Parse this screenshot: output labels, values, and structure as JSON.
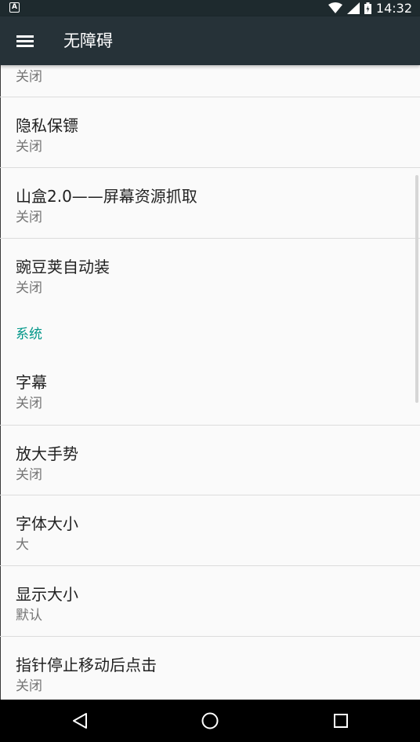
{
  "status_bar": {
    "time": "14:32",
    "left_icon": "A"
  },
  "app_bar": {
    "title": "无障碍"
  },
  "list": {
    "partial_item_sub": "关闭",
    "items_top": [
      {
        "title": "隐私保镖",
        "sub": "关闭"
      },
      {
        "title": "山盒2.0——屏幕资源抓取",
        "sub": "关闭"
      },
      {
        "title": "豌豆荚自动装",
        "sub": "关闭"
      }
    ],
    "section_system": "系统",
    "items_system": [
      {
        "title": "字幕",
        "sub": "关闭"
      },
      {
        "title": "放大手势",
        "sub": "关闭"
      },
      {
        "title": "字体大小",
        "sub": "大"
      },
      {
        "title": "显示大小",
        "sub": "默认"
      },
      {
        "title": "指针停止移动后点击",
        "sub": "关闭"
      }
    ]
  },
  "colors": {
    "app_bar": "#263238",
    "status_bar": "#1e2a2e",
    "accent": "#009688",
    "background": "#fafafa"
  },
  "icons": {
    "menu": "menu-icon",
    "wifi": "wifi-icon",
    "signal": "signal-icon",
    "battery": "battery-icon",
    "back": "back-icon",
    "home": "home-icon",
    "recents": "recents-icon"
  }
}
